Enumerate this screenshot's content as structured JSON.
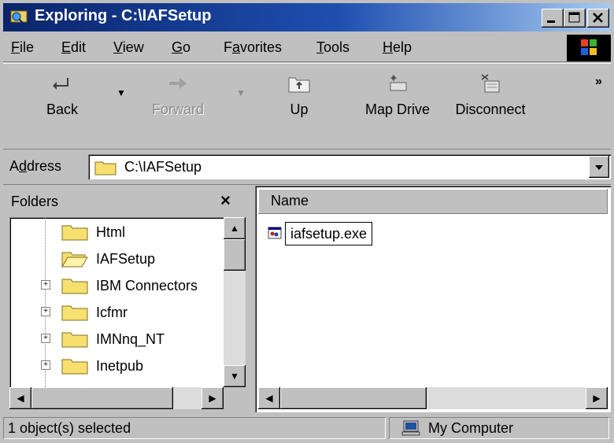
{
  "window": {
    "title": "Exploring - C:\\IAFSetup"
  },
  "menu": [
    {
      "label": "File",
      "accel": "F",
      "rest": "ile"
    },
    {
      "label": "Edit",
      "accel": "E",
      "rest": "dit"
    },
    {
      "label": "View",
      "accel": "V",
      "rest": "iew"
    },
    {
      "label": "Go",
      "accel": "G",
      "rest": "o"
    },
    {
      "label": "Favorites",
      "pre": "F",
      "accel": "a",
      "rest": "vorites"
    },
    {
      "label": "Tools",
      "accel": "T",
      "rest": "ools"
    },
    {
      "label": "Help",
      "accel": "H",
      "rest": "elp"
    }
  ],
  "toolbar": {
    "back": "Back",
    "forward": "Forward",
    "up": "Up",
    "map_drive": "Map Drive",
    "disconnect": "Disconnect",
    "more": "»"
  },
  "address": {
    "label_pre": "A",
    "label_accel": "d",
    "label_rest": "dress",
    "value": "C:\\IAFSetup"
  },
  "folders": {
    "title": "Folders",
    "close": "×",
    "items": [
      {
        "label": "Html",
        "expander": ""
      },
      {
        "label": "IAFSetup",
        "expander": "",
        "open": true
      },
      {
        "label": "IBM Connectors",
        "expander": "+"
      },
      {
        "label": "Icfmr",
        "expander": "+"
      },
      {
        "label": "IMNnq_NT",
        "expander": "+"
      },
      {
        "label": "Inetpub",
        "expander": "+"
      }
    ]
  },
  "content": {
    "column_name": "Name",
    "files": [
      {
        "name": "iafsetup.exe"
      }
    ]
  },
  "status": {
    "selected": "1 object(s) selected",
    "location": "My Computer"
  }
}
